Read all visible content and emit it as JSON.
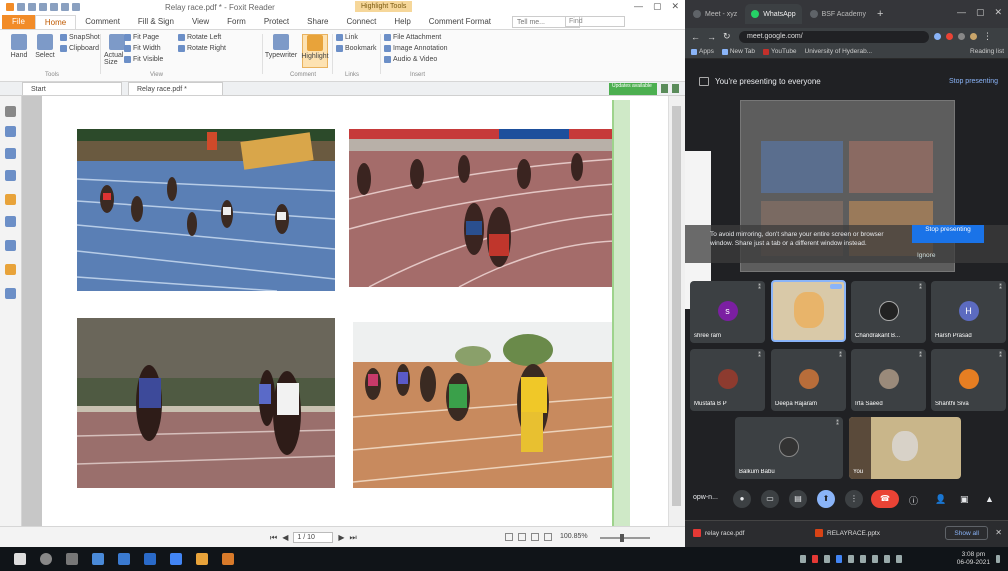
{
  "pdf_editor": {
    "window_title": "Relay race.pdf * - Foxit Reader",
    "context_badge": "Highlight Tools",
    "quick_access": [
      "save",
      "print",
      "undo",
      "redo",
      "open",
      "hand"
    ],
    "window_controls": [
      "—",
      "▢",
      "✕"
    ],
    "file_tab": "File",
    "ribbon_tabs": [
      "Home",
      "Comment",
      "Fill & Sign",
      "View",
      "Form",
      "Protect",
      "Share",
      "Connect",
      "Help",
      "Comment Format"
    ],
    "active_tab": "Home",
    "tell_me": "Tell me...",
    "find": "Find",
    "ribbon": {
      "g1": [
        "Hand",
        "Select"
      ],
      "g2": [
        "SnapShot",
        "Clipboard"
      ],
      "g3": [
        "Fit Page",
        "Fit Width",
        "Fit Visible"
      ],
      "g3b": [
        "Actual Size"
      ],
      "g4": [
        "Rotate Left",
        "Rotate Right"
      ],
      "g5_big": [
        "Typewriter",
        "Highlight"
      ],
      "g6": [
        "Link",
        "Bookmark"
      ],
      "g7": [
        "File Attachment",
        "Image Annotation",
        "Audio & Video"
      ],
      "labels": [
        "Tools",
        "View",
        "Comment",
        "Links",
        "Insert"
      ]
    },
    "doc_tabs": [
      "Start",
      "Relay race.pdf *"
    ],
    "notification": "Updates available",
    "status": {
      "page": "1 / 10",
      "zoom": "100.85%"
    }
  },
  "browser": {
    "tabs": [
      {
        "label": "Meet - xyz",
        "active": false
      },
      {
        "label": "WhatsApp",
        "active": true
      },
      {
        "label": "BSF Academy",
        "active": false
      }
    ],
    "new_tab": "+",
    "window_controls": [
      "—",
      "▢",
      "✕"
    ],
    "url": "meet.google.com/",
    "bookmarks": [
      "Apps",
      "New Tab",
      "YouTube",
      "University of Hyderab...",
      "Reading list"
    ],
    "presenting_text": "You're presenting to everyone",
    "stop_presenting": "Stop presenting",
    "warning_text": "To avoid mirroring, don't share your entire screen or browser window. Share just a tab or a different window instead.",
    "warning_button": "Stop presenting",
    "warning_ignore": "Ignore",
    "participants": [
      {
        "name": "shree ram",
        "initial": "s",
        "color": "#7b1fa2",
        "video": false
      },
      {
        "name": "",
        "initial": "",
        "color": "#e8b46a",
        "video": true
      },
      {
        "name": "Chandrakant B...",
        "initial": "",
        "color": "#222",
        "video": false
      },
      {
        "name": "Harsh Prasad",
        "initial": "H",
        "color": "#5c6bc0",
        "video": false
      },
      {
        "name": "Mustafa B P",
        "initial": "",
        "color": "#8d3b2f",
        "video": false
      },
      {
        "name": "Deepa Rajaram",
        "initial": "",
        "color": "#b86d3a",
        "video": false
      },
      {
        "name": "Irfa Saeed",
        "initial": "",
        "color": "#9a8a7a",
        "video": false
      },
      {
        "name": "Shanthi Siva",
        "initial": "",
        "color": "#e67e22",
        "video": false
      },
      {
        "name": "Balkum Babu",
        "initial": "",
        "color": "#333",
        "video": false
      },
      {
        "name": "You",
        "initial": "",
        "color": "#c9b68a",
        "video": true
      }
    ],
    "meeting_code": "opw-n...",
    "downloads": [
      {
        "name": "relay race.pdf",
        "color": "#e53935"
      },
      {
        "name": "RELAYRACE.pptx",
        "color": "#d84315"
      }
    ],
    "show_all": "Show all"
  },
  "taskbar": {
    "time": "3:08 pm",
    "date": "06-09-2021"
  }
}
